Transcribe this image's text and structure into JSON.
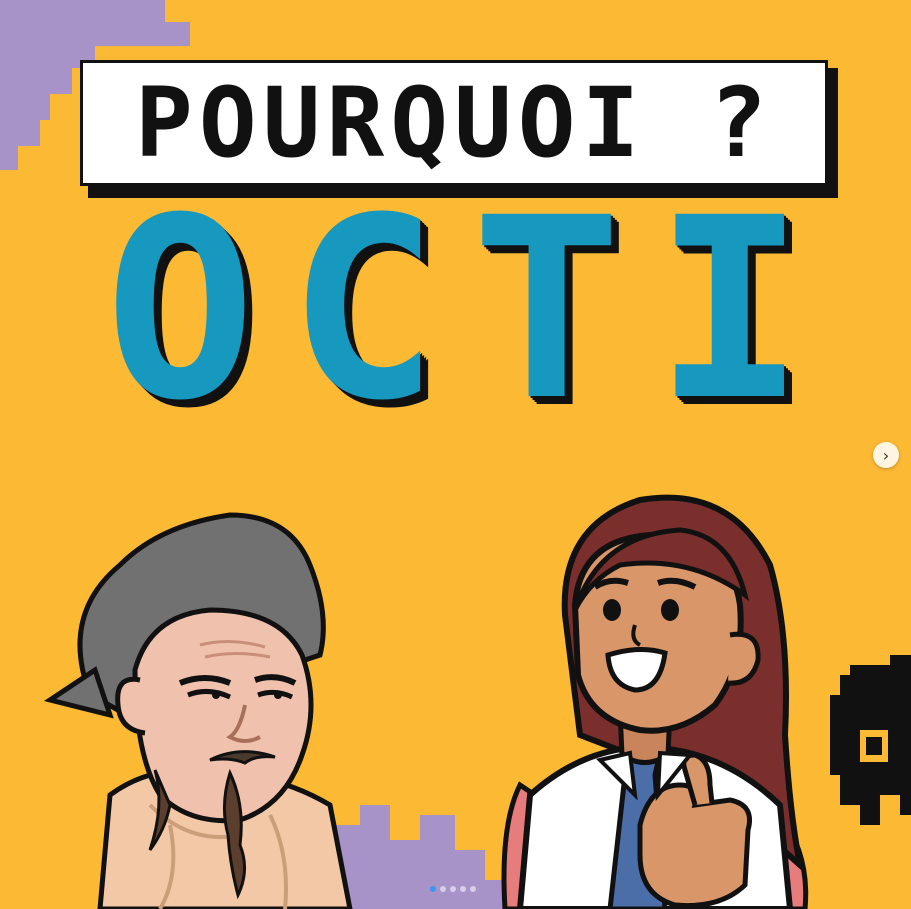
{
  "title": "POURQUOI ?",
  "headline_letters": [
    "O",
    "C",
    "T",
    "I"
  ],
  "carousel": {
    "next_icon": "chevron-right-icon",
    "next_glyph": "›",
    "slide_count": 5,
    "active_index": 1
  },
  "colors": {
    "background": "#fbb934",
    "accent_blue": "#1698bf",
    "purple": "#a893c9"
  }
}
